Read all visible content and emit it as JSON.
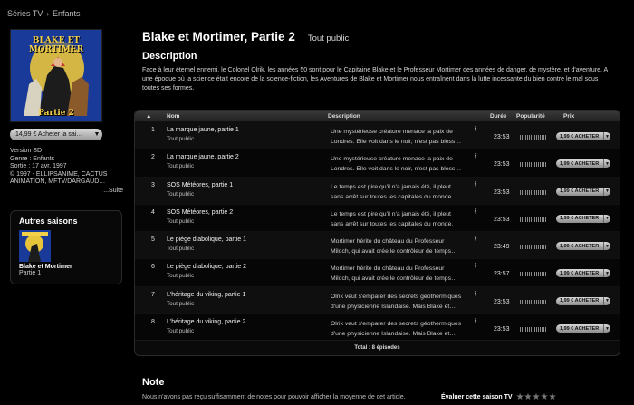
{
  "breadcrumb": [
    "Séries TV",
    "Enfants"
  ],
  "show": {
    "title": "Blake et Mortimer, Partie 2",
    "rating": "Tout public",
    "cover_logo": "BLAKE ET MORTIMER",
    "cover_part": "Partie 2"
  },
  "buy_button": "14,99 € Acheter la sai…",
  "meta": {
    "version": "Version SD",
    "genre": "Genre : Enfants",
    "release": "Sortie : 17 avr. 1997",
    "copyright": "© 1997 - ELLIPSANIME, CACTUS ANIMATION, MFTV/DARGAUD…",
    "suite": "...Suite"
  },
  "other_seasons": {
    "heading": "Autres saisons",
    "title": "Blake et Mortimer",
    "subtitle": "Partie 1"
  },
  "description": {
    "heading": "Description",
    "text": "Face à leur éternel ennemi, le Colonel Olrik, les années 50 sont pour le Capitaine Blake et le Professeur Mortimer des années de danger, de mystère, et d'aventure. A une époque où la science était encore de la science-fiction, les Aventures de Blake et Mortimer nous entraînent dans la lutte incessante du bien contre le mal sous toutes ses formes."
  },
  "table": {
    "headers": {
      "sort": "▲",
      "name": "Nom",
      "description": "Description",
      "duration": "Durée",
      "popularity": "Popularité",
      "price": "Prix"
    },
    "episodes": [
      {
        "num": "1",
        "name": "La marque jaune, partie 1",
        "sub": "Tout public",
        "desc": "Une mystérieuse créature menace la paix de Londres. Elle voit dans le noir, n'est pas bless…",
        "info": "i",
        "duration": "23:53",
        "price": "1,99 € ACHETER"
      },
      {
        "num": "2",
        "name": "La marque jaune, partie 2",
        "sub": "Tout public",
        "desc": "Une mystérieuse créature menace la paix de Londres. Elle voit dans le noir, n'est pas bless…",
        "info": "i",
        "duration": "23:53",
        "price": "1,99 € ACHETER"
      },
      {
        "num": "3",
        "name": "SOS Météores, partie 1",
        "sub": "Tout public",
        "desc": "Le temps est pire qu'il n'a jamais été, il pleut sans arrêt sur toutes les capitales du monde.",
        "info": "i",
        "duration": "23:53",
        "price": "1,99 € ACHETER"
      },
      {
        "num": "4",
        "name": "SOS Météores, partie 2",
        "sub": "Tout public",
        "desc": "Le temps est pire qu'il n'a jamais été, il pleut sans arrêt sur toutes les capitales du monde.",
        "info": "i",
        "duration": "23:53",
        "price": "1,99 € ACHETER"
      },
      {
        "num": "5",
        "name": "Le piège diabolique, partie 1",
        "sub": "Tout public",
        "desc": "Mortimer hérite du château du Professeur Miloch, qui avait crée le contrôleur de temps…",
        "info": "i",
        "duration": "23:49",
        "price": "1,99 € ACHETER"
      },
      {
        "num": "6",
        "name": "Le piège diabolique, partie 2",
        "sub": "Tout public",
        "desc": "Mortimer hérite du château du Professeur Miloch, qui avait crée le contrôleur de temps…",
        "info": "i",
        "duration": "23:57",
        "price": "1,99 € ACHETER"
      },
      {
        "num": "7",
        "name": "L'héritage du viking, partie 1",
        "sub": "Tout public",
        "desc": "Olrik veut s'emparer des secrets géothermiques d'une physicienne Islandaise. Mais Blake et…",
        "info": "i",
        "duration": "23:53",
        "price": "1,99 € ACHETER"
      },
      {
        "num": "8",
        "name": "L'héritage du viking, partie 2",
        "sub": "Tout public",
        "desc": "Olrik veut s'emparer des secrets géothermiques d'une physicienne Islandaise. Mais Blake et…",
        "info": "i",
        "duration": "23:53",
        "price": "1,99 € ACHETER"
      }
    ],
    "total": "Total : 8 épisodes"
  },
  "note": {
    "heading": "Note",
    "text": "Nous n'avons pas reçu suffisamment de notes pour pouvoir afficher la moyenne de cet article.",
    "evaluate": "Évaluer cette saison TV",
    "stars": "★★★★★"
  },
  "colors": {
    "background": "#000000",
    "cover_blue": "#1a3a9a",
    "cover_yellow": "#e8c43a"
  }
}
